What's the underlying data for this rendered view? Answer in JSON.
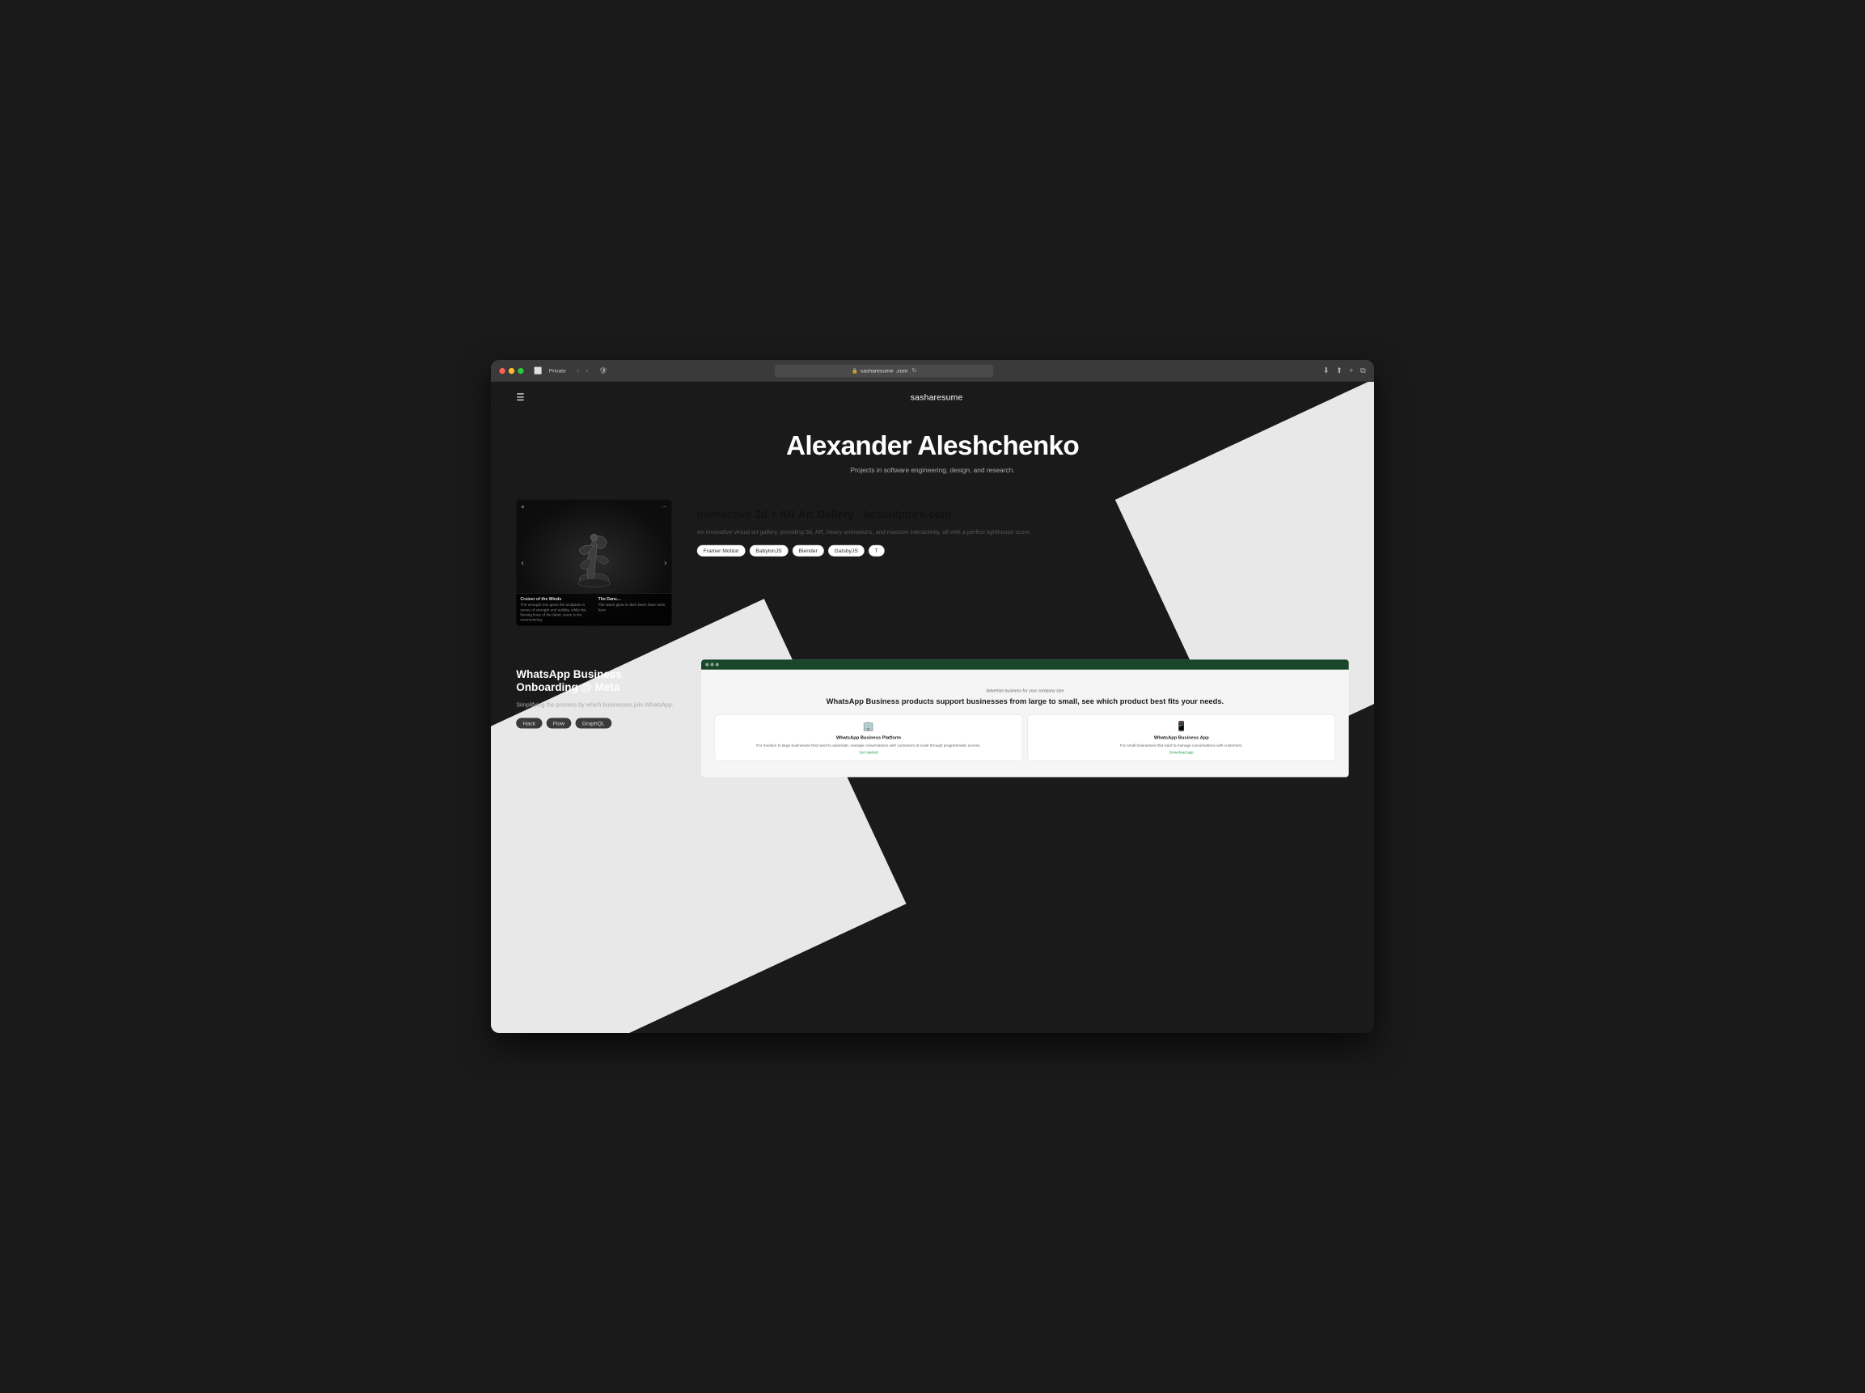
{
  "browser": {
    "title_bar": {
      "traffic_lights": [
        "red",
        "yellow",
        "green"
      ],
      "private_label": "Private",
      "nav_back": "‹",
      "nav_forward": "›",
      "shield_icon": "shield",
      "url": "sasharesume.com",
      "lock_icon": "🔒",
      "refresh_icon": "↻",
      "download_icon": "⬇",
      "share_icon": "⬆",
      "new_tab_icon": "+",
      "tabs_icon": "⧉"
    }
  },
  "website": {
    "nav": {
      "menu_icon": "☰",
      "site_title": "sasharesume"
    },
    "hero": {
      "name": "Alexander Aleshchenko",
      "subtitle": "Projects in software engineering, design, and research."
    },
    "projects": [
      {
        "id": "art-gallery",
        "title": "Interactive 3d + AR Art Gallery - bcsculpture.com",
        "description": "An innovative virtual art gallery, providing 3d, AR, heavy animations, and massive interactivity, all with a perfect lighthouse score.",
        "carousel_items": [
          {
            "name": "Cruiser of the Winds",
            "desc": "The wrought iron gives the sculpture a sense of strength and solidity, while the flowing lines of the fabric seem to be mesmerizing"
          },
          {
            "name": "The Danc...",
            "desc": "The warm glow is often been have seen here"
          }
        ],
        "tags": [
          "Framer Motion",
          "BabylonJS",
          "Blender",
          "GatsbyJS",
          "T..."
        ]
      },
      {
        "id": "whatsapp",
        "title": "WhatsApp Business Onboarding @ Meta",
        "description": "Simplifying the process by which businesses join WhatsApp.",
        "tags": [
          "Hack",
          "Flow",
          "GraphQL"
        ],
        "mockup": {
          "small_text": "Advertise business for your company size",
          "heading": "WhatsApp Business products support businesses from large to small, see which product best fits your needs.",
          "cards": [
            {
              "title": "WhatsApp Business Platform",
              "desc": "For medium to large businesses that need to automate, manage conversations with customers at scale through programmatic access.",
              "link": "Get started"
            },
            {
              "title": "WhatsApp Business App",
              "desc": "For small businesses that want to manage conversations with customers.",
              "link": "Download app"
            }
          ]
        }
      }
    ]
  }
}
